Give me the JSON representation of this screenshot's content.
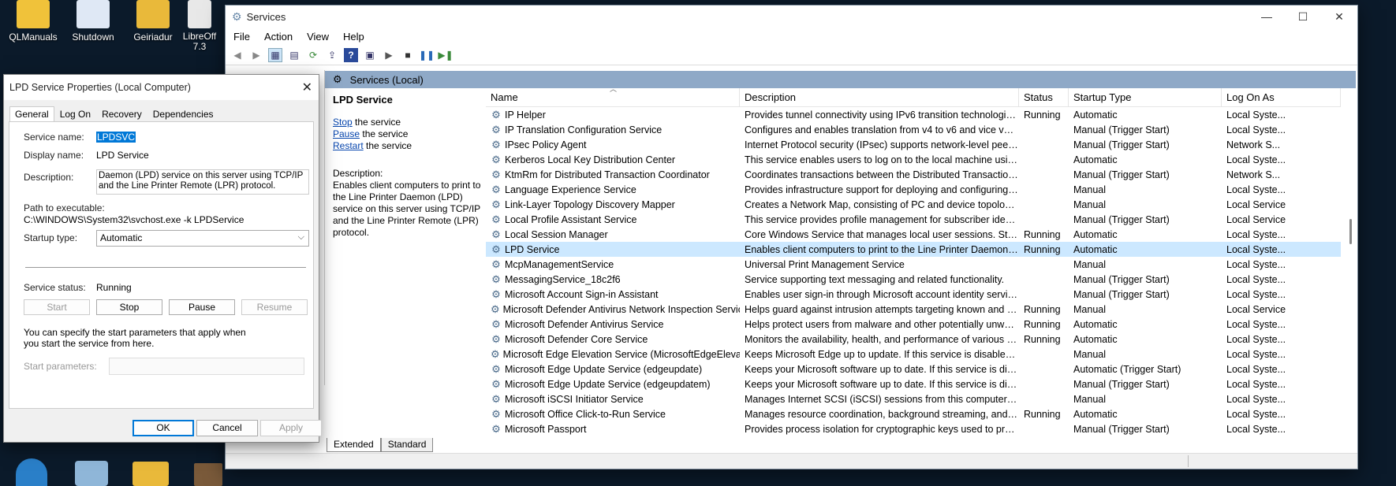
{
  "desktop": {
    "icons": [
      {
        "label": "QLManuals",
        "color": "#f0c23a"
      },
      {
        "label": "Shutdown",
        "color": "#dfe8f5"
      },
      {
        "label": "Geiriadur",
        "color": "#e9b93a"
      },
      {
        "label": "LibreOff 7.3",
        "color": "#e8e8e8"
      }
    ]
  },
  "services_window": {
    "title": "Services",
    "controls": {
      "minimize": "—",
      "maximize": "☐",
      "close": "✕"
    },
    "menu": [
      "File",
      "Action",
      "View",
      "Help"
    ],
    "header": "Services (Local)",
    "detail": {
      "name": "LPD Service",
      "stop_link": "Stop",
      "stop_rest": " the service",
      "pause_link": "Pause",
      "pause_rest": " the service",
      "restart_link": "Restart",
      "restart_rest": " the service",
      "description_label": "Description:",
      "description": "Enables client computers to print to the Line Printer Daemon (LPD) service on this server using TCP/IP and the Line Printer Remote (LPR) protocol."
    },
    "columns": {
      "name": "Name",
      "description": "Description",
      "status": "Status",
      "startup": "Startup Type",
      "logon": "Log On As"
    },
    "rows": [
      [
        "IP Helper",
        "Provides tunnel connectivity using IPv6 transition technologies...",
        "Running",
        "Automatic",
        "Local Syste..."
      ],
      [
        "IP Translation Configuration Service",
        "Configures and enables translation from v4 to v6 and vice versa",
        "",
        "Manual (Trigger Start)",
        "Local Syste..."
      ],
      [
        "IPsec Policy Agent",
        "Internet Protocol security (IPsec) supports network-level peer a...",
        "",
        "Manual (Trigger Start)",
        "Network S..."
      ],
      [
        "Kerberos Local Key Distribution Center",
        "This service enables users to log on to the local machine using ...",
        "",
        "Automatic",
        "Local Syste..."
      ],
      [
        "KtmRm for Distributed Transaction Coordinator",
        "Coordinates transactions between the Distributed Transaction ...",
        "",
        "Manual (Trigger Start)",
        "Network S..."
      ],
      [
        "Language Experience Service",
        "Provides infrastructure support for deploying and configuring l...",
        "",
        "Manual",
        "Local Syste..."
      ],
      [
        "Link-Layer Topology Discovery Mapper",
        "Creates a Network Map, consisting of PC and device topology (...",
        "",
        "Manual",
        "Local Service"
      ],
      [
        "Local Profile Assistant Service",
        "This service provides profile management for subscriber identit...",
        "",
        "Manual (Trigger Start)",
        "Local Service"
      ],
      [
        "Local Session Manager",
        "Core Windows Service that manages local user sessions. Stoppi...",
        "Running",
        "Automatic",
        "Local Syste..."
      ],
      [
        "LPD Service",
        "Enables client computers to print to the Line Printer Daemon (L...",
        "Running",
        "Automatic",
        "Local Syste..."
      ],
      [
        "McpManagementService",
        "Universal Print Management Service",
        "",
        "Manual",
        "Local Syste..."
      ],
      [
        "MessagingService_18c2f6",
        "Service supporting text messaging and related functionality.",
        "",
        "Manual (Trigger Start)",
        "Local Syste..."
      ],
      [
        "Microsoft Account Sign-in Assistant",
        "Enables user sign-in through Microsoft account identity service...",
        "",
        "Manual (Trigger Start)",
        "Local Syste..."
      ],
      [
        "Microsoft Defender Antivirus Network Inspection Service",
        "Helps guard against intrusion attempts targeting known and n...",
        "Running",
        "Manual",
        "Local Service"
      ],
      [
        "Microsoft Defender Antivirus Service",
        "Helps protect users from malware and other potentially unwan...",
        "Running",
        "Automatic",
        "Local Syste..."
      ],
      [
        "Microsoft Defender Core Service",
        "Monitors the availability, health, and performance of various se...",
        "Running",
        "Automatic",
        "Local Syste..."
      ],
      [
        "Microsoft Edge Elevation Service (MicrosoftEdgeElevati...",
        "Keeps Microsoft Edge up to update. If this service is disabled, t...",
        "",
        "Manual",
        "Local Syste..."
      ],
      [
        "Microsoft Edge Update Service (edgeupdate)",
        "Keeps your Microsoft software up to date. If this service is disab...",
        "",
        "Automatic (Trigger Start)",
        "Local Syste..."
      ],
      [
        "Microsoft Edge Update Service (edgeupdatem)",
        "Keeps your Microsoft software up to date. If this service is disab...",
        "",
        "Manual (Trigger Start)",
        "Local Syste..."
      ],
      [
        "Microsoft iSCSI Initiator Service",
        "Manages Internet SCSI (iSCSI) sessions from this computer to r...",
        "",
        "Manual",
        "Local Syste..."
      ],
      [
        "Microsoft Office Click-to-Run Service",
        "Manages resource coordination, background streaming, and sy...",
        "Running",
        "Automatic",
        "Local Syste..."
      ],
      [
        "Microsoft Passport",
        "Provides process isolation for cryptographic keys used to provi...",
        "",
        "Manual (Trigger Start)",
        "Local Syste..."
      ]
    ],
    "selected_row": "LPD Service",
    "tabs": [
      "Extended",
      "Standard"
    ]
  },
  "properties_dialog": {
    "title": "LPD Service Properties (Local Computer)",
    "close": "✕",
    "tabs": [
      "General",
      "Log On",
      "Recovery",
      "Dependencies"
    ],
    "service_name_label": "Service name:",
    "service_name": "LPDSVC",
    "display_name_label": "Display name:",
    "display_name": "LPD Service",
    "description_label": "Description:",
    "description": "Daemon (LPD) service on this server using TCP/IP and the Line Printer Remote (LPR) protocol.",
    "path_label": "Path to executable:",
    "path": "C:\\WINDOWS\\System32\\svchost.exe -k LPDService",
    "startup_label": "Startup type:",
    "startup_value": "Automatic",
    "status_label": "Service status:",
    "status_value": "Running",
    "btn_start": "Start",
    "btn_stop": "Stop",
    "btn_pause": "Pause",
    "btn_resume": "Resume",
    "note": "You can specify the start parameters that apply when you start the service from here.",
    "params_label": "Start parameters:",
    "ok": "OK",
    "cancel": "Cancel",
    "apply": "Apply"
  }
}
